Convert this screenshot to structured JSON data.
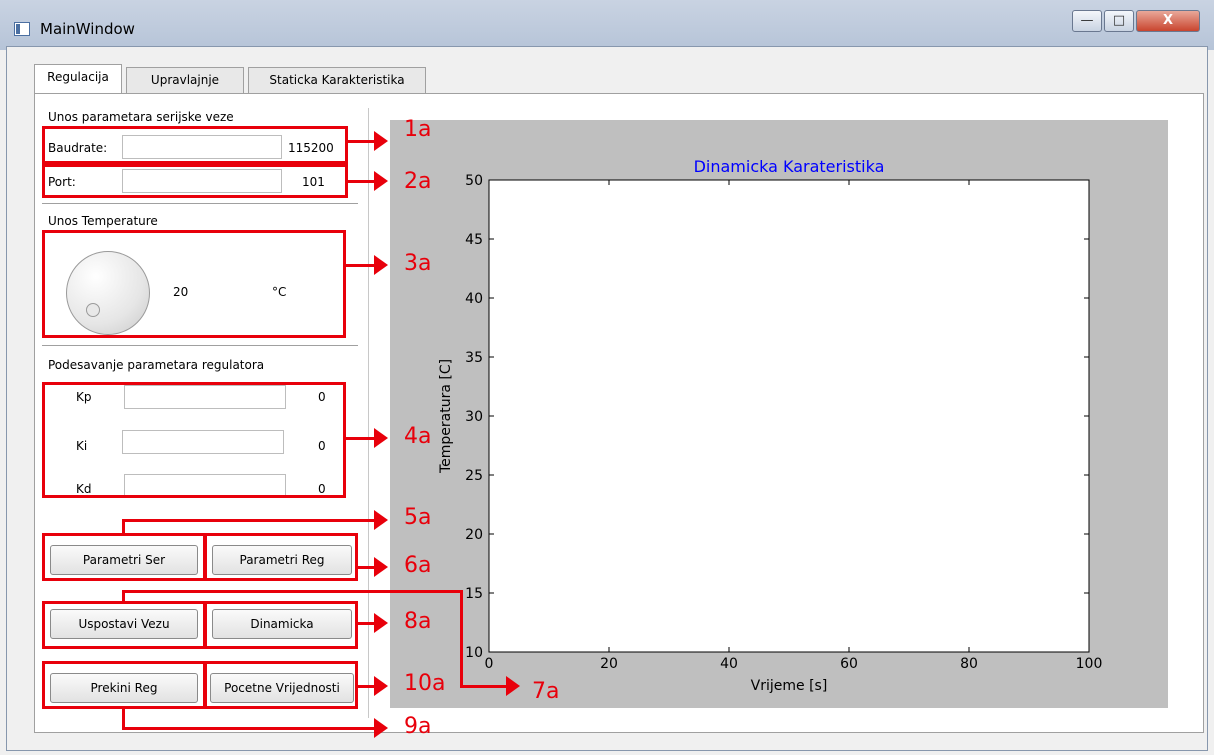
{
  "window": {
    "title": "MainWindow",
    "close_label": "X"
  },
  "tabs": [
    "Regulacija",
    "Upravlajnje",
    "Staticka Karakteristika"
  ],
  "serial": {
    "section_title": "Unos parametara serijske veze",
    "baudrate_label": "Baudrate:",
    "baudrate_value": "115200",
    "port_label": "Port:",
    "port_value": "101"
  },
  "temperature": {
    "section_title": "Unos Temperature",
    "value": "20",
    "unit": "°C"
  },
  "regulator": {
    "section_title": "Podesavanje parametara regulatora",
    "kp_label": "Kp",
    "kp_value": "0",
    "ki_label": "Ki",
    "ki_value": "0",
    "kd_label": "Kd",
    "kd_value": "0"
  },
  "buttons": {
    "parametri_ser": "Parametri Ser",
    "parametri_reg": "Parametri Reg",
    "uspostavi_vezu": "Uspostavi Vezu",
    "dinamicka": "Dinamicka",
    "prekini_reg": "Prekini Reg",
    "pocetne_vrijednosti": "Pocetne Vrijednosti"
  },
  "annotations": [
    "1a",
    "2a",
    "3a",
    "4a",
    "5a",
    "6a",
    "7a",
    "8a",
    "9a",
    "10a"
  ],
  "colors": {
    "annotation": "#e8000b",
    "chart_title": "#0000ff",
    "plot_background": "#bfbfbf"
  },
  "chart_data": {
    "type": "line",
    "title": "Dinamicka Karateristika",
    "xlabel": "Vrijeme [s]",
    "ylabel": "Temperatura [C]",
    "xlim": [
      0,
      100
    ],
    "ylim": [
      10,
      50
    ],
    "xticks": [
      0,
      20,
      40,
      60,
      80,
      100
    ],
    "yticks": [
      10,
      15,
      20,
      25,
      30,
      35,
      40,
      45,
      50
    ],
    "grid": false,
    "series": []
  }
}
